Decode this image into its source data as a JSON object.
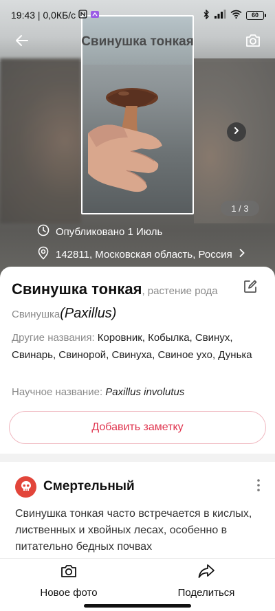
{
  "status_bar": {
    "time_speed": "19:43 | 0,0КБ/с",
    "battery": "60"
  },
  "header": {
    "title": "Свинушка тонкая",
    "photo_counter": "1 / 3",
    "published": "Опубликовано 1 Июль",
    "location": "142811, Московская область, Россия"
  },
  "card": {
    "name": "Свинушка тонкая",
    "name_suffix": ", растение рода",
    "genus_ru": "Свинушка",
    "genus_lat": "(Paxillus)",
    "other_names_label": "Другие названия: ",
    "other_names_value": "Коровник, Кобылка, Свинух, Свинарь, Свинорой, Свинуха, Свиное ухо, Дунька",
    "scientific_label": "Научное название: ",
    "scientific_value": "Paxillus involutus",
    "add_note_label": "Добавить заметку"
  },
  "toxicity": {
    "title": "Смертельный",
    "text": "Свинушка тонкая часто встречается в кислых, лиственных и хвойных лесах, особенно в питательно бедных почвах"
  },
  "bottom_nav": {
    "new_photo": "Новое фото",
    "share": "Поделиться"
  },
  "colors": {
    "accent": "#e0344e",
    "toxic": "#e2453a"
  },
  "icons": [
    "back-arrow-icon",
    "camera-icon",
    "chevron-right-icon",
    "clock-icon",
    "location-pin-icon",
    "edit-icon",
    "skull-icon",
    "more-vertical-icon",
    "share-icon"
  ]
}
